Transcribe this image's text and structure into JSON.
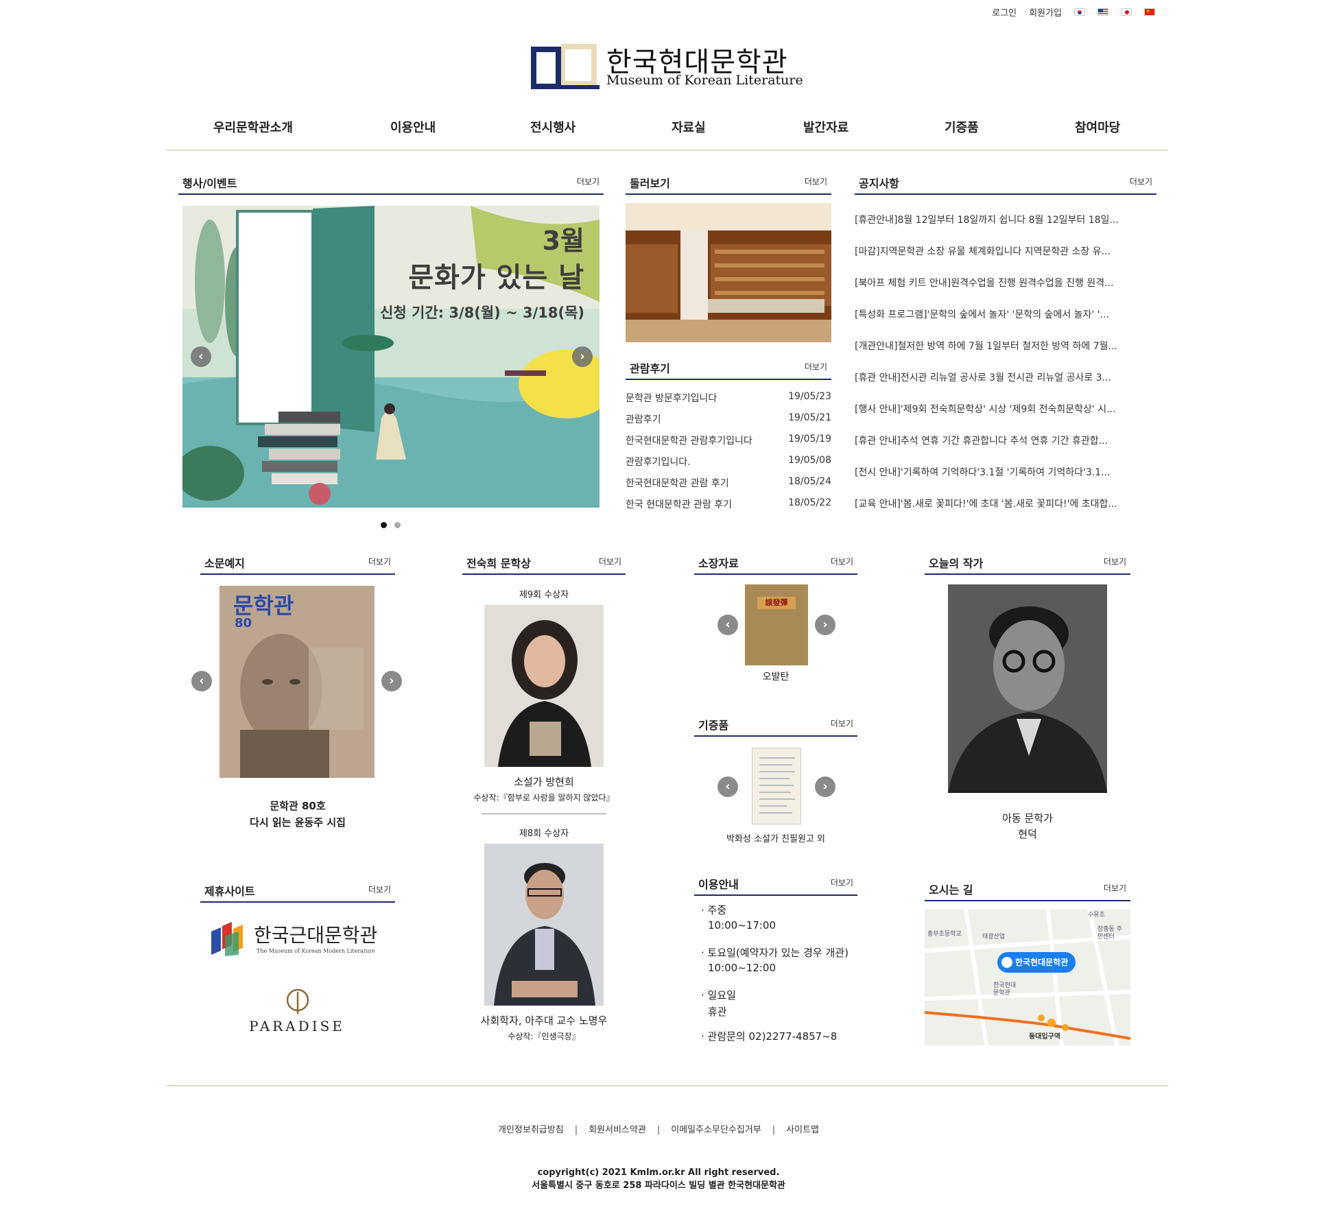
{
  "top_links": {
    "login": "로그인",
    "signup": "회원가입"
  },
  "logo": {
    "ko": "한국현대문학관",
    "en": "Museum of Korean Literature"
  },
  "nav": [
    "우리문학관소개",
    "이용안내",
    "전시행사",
    "자료실",
    "발간자료",
    "기증품",
    "참여마당"
  ],
  "more_label": "더보기",
  "events": {
    "title": "행사/이벤트",
    "banner_month": "3월",
    "banner_heading": "문화가 있는 날",
    "banner_period": "신청 기간: 3/8(월) ~ 3/18(목)"
  },
  "tour": {
    "title": "둘러보기"
  },
  "reviews": {
    "title": "관람후기",
    "items": [
      {
        "title": "문학관 방문후기입니다",
        "date": "19/05/23"
      },
      {
        "title": "관람후기",
        "date": "19/05/21"
      },
      {
        "title": "한국현대문학관 관람후기입니다",
        "date": "19/05/19"
      },
      {
        "title": "관람후기입니다.",
        "date": "19/05/08"
      },
      {
        "title": "한국현대문학관 관람 후기",
        "date": "18/05/24"
      },
      {
        "title": "한국 현대문학관 관람 후기",
        "date": "18/05/22"
      }
    ]
  },
  "notices": {
    "title": "공지사항",
    "items": [
      "[휴관안내]8월 12일부터 18일까지 쉽니다 8월 12일부터 18일...",
      "[마감]지역문학관 소장 유물 체계화입니다 지역문학관 소장 유...",
      "[북아프 체험 키트 안내]원격수업을 진행 원격수업을 진행 원격...",
      "[특성화 프로그램]'문학의 숲에서 놀자' '문학의 숲에서 놀자' '...",
      "[개관안내]철저한 방역 하에 7월 1일부터 철저한 방역 하에 7월...",
      "[휴관 안내]전시관 리뉴얼 공사로 3월 전시관 리뉴얼 공사로 3...",
      "[행사 안내]'제9회 전숙희문학상' 시상 '제9회 전숙희문학상' 시...",
      "[휴관 안내]추석 연휴 기간 휴관합니다 추석 연휴 기간 휴관합...",
      "[전시 안내]'기록하여 기억하다'3.1절 '기록하여 기억하다'3.1...",
      "[교육 안내]'봄.새로 꽃피다!'에 초대 '봄.새로 꽃피다!'에 초대합..."
    ]
  },
  "magazine": {
    "title": "소문예지",
    "cover_title": "문학관",
    "cover_issue": "80",
    "caption_line1": "문학관 80호",
    "caption_line2": "다시 읽는 윤동주 시집"
  },
  "award": {
    "title": "전숙희 문학상",
    "winner9_label": "제9회 수상자",
    "winner9_name": "소설가 방현희",
    "winner9_work": "수상작:『함부로 사랑을 말하지 않았다』",
    "winner8_label": "제8회 수상자",
    "winner8_name": "사회학자, 아주대 교수 노명우",
    "winner8_work": "수상작:『인생극장』"
  },
  "collection": {
    "title": "소장자료",
    "caption": "오발탄",
    "book_title": "誤發彈"
  },
  "donations": {
    "title": "기증품",
    "caption": "박화성 소설가 친필원고 외"
  },
  "author": {
    "title": "오늘의 작가",
    "caption_line1": "아동 문학가",
    "caption_line2": "현덕"
  },
  "partners": {
    "title": "제휴사이트",
    "partner1_ko": "한국근대문학관",
    "partner1_en": "The Museum of Korean Modern Literature",
    "partner2": "PARADISE"
  },
  "usage": {
    "title": "이용안내",
    "lines": [
      "· 주중",
      "10:00~17:00",
      "· 토요일(예약자가 있는 경우 개관)",
      "10:00~12:00",
      "· 일요일",
      "휴관",
      "· 관람문의 02)2277-4857~8"
    ]
  },
  "directions": {
    "title": "오시는 길",
    "map_label": "한국현대문학관",
    "map_poi1": "충무초등학교",
    "map_poi2": "태광산업",
    "map_poi3": "장충동 주민센터",
    "map_poi4": "한국현대 문학관",
    "map_poi5": "동대입구역",
    "map_top": "수유초"
  },
  "footer": {
    "links": [
      "개인정보취급방침",
      "회원서비스약관",
      "이메일주소무단수집거부",
      "사이트맵"
    ],
    "copyright": "copyright(c) 2021 Kmlm.or.kr All right reserved.",
    "address": "서울특별시 중구 동호로 258 파라다이스 빌딩 별관 한국현대문학관"
  },
  "colors": {
    "navy": "#1d2a6a",
    "beige_rule": "#e8dcc0",
    "map_pin": "#1a7ef0"
  }
}
